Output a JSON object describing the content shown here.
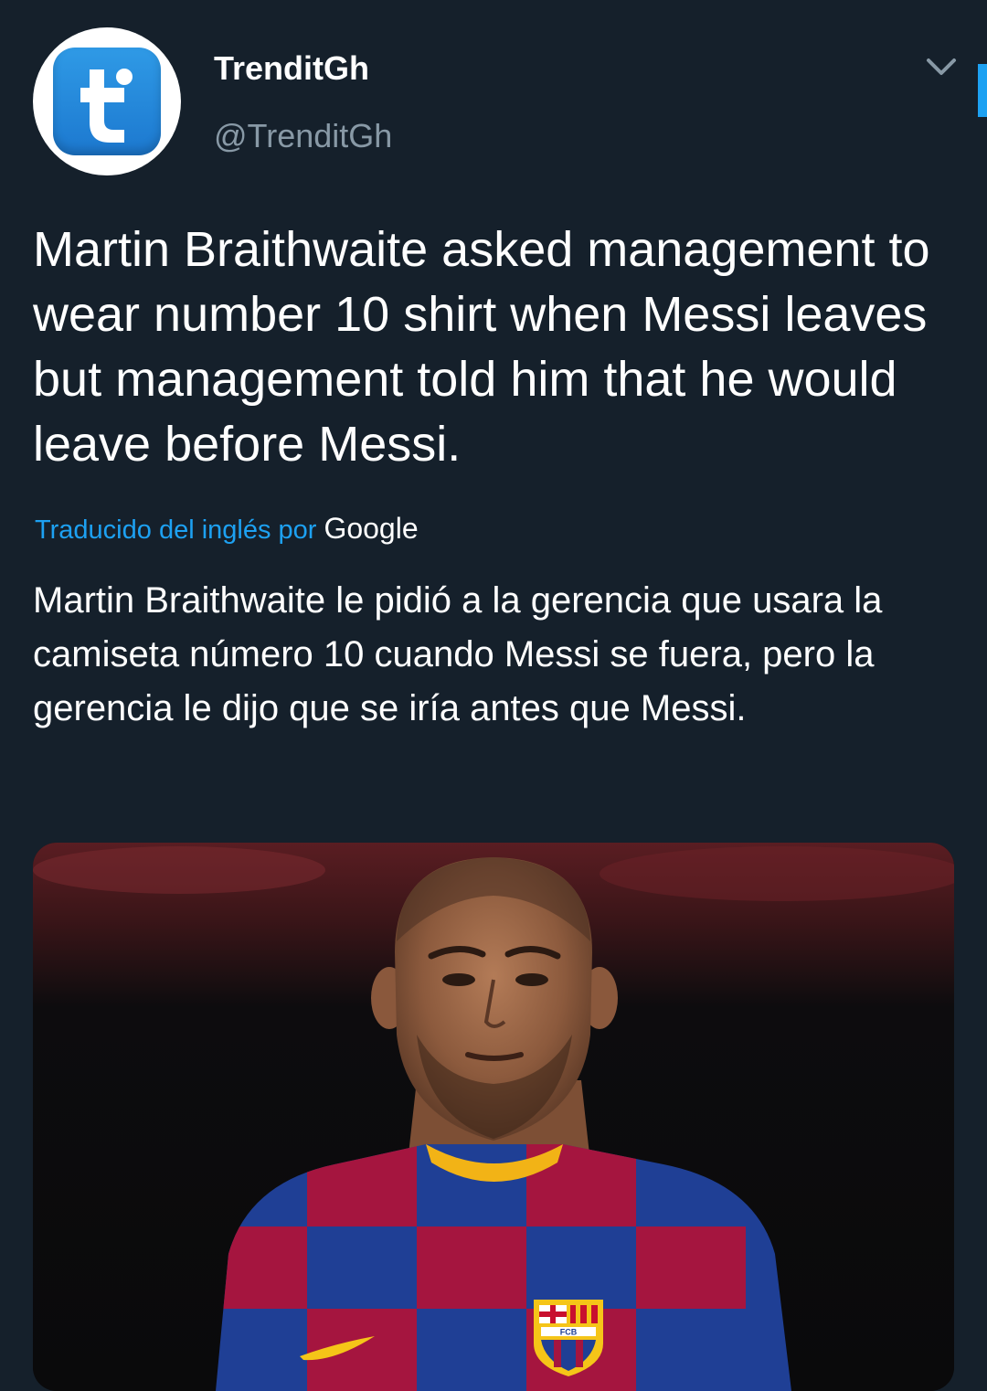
{
  "author": {
    "display_name": "TrenditGh",
    "handle": "@TrenditGh",
    "avatar_icon": "trenditgh-logo-icon"
  },
  "tweet": {
    "text": "Martin Braithwaite asked management to wear number 10 shirt when Messi leaves but management told him that he would leave before Messi."
  },
  "translation": {
    "label": "Traducido del inglés por",
    "provider": "Google",
    "text": "Martin Braithwaite le pidió a la gerencia que usara la camiseta número 10 cuando Messi se fuera, pero la gerencia le dijo que se iría antes que Messi."
  },
  "media": {
    "type": "photo",
    "jersey_crest_text": "FCB"
  },
  "colors": {
    "background": "#15202b",
    "accent": "#1da1f2",
    "secondary_text": "#8899a6"
  }
}
